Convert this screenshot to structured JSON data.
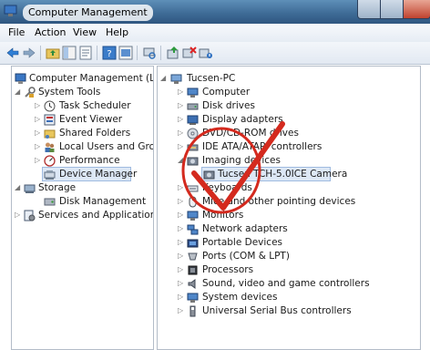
{
  "window": {
    "title": "Computer Management"
  },
  "menu": [
    "File",
    "Action",
    "View",
    "Help"
  ],
  "toolbar": {
    "icons": [
      "back-arrow-icon",
      "forward-arrow-icon",
      "up-folder-icon",
      "show-hide-tree-icon",
      "properties-icon",
      "help-icon",
      "console-tree-icon",
      "scan-hardware-icon",
      "update-driver-icon",
      "uninstall-device-icon",
      "disable-device-icon"
    ]
  },
  "left_tree": {
    "root": "Computer Management (Local",
    "system_tools": "System Tools",
    "task_scheduler": "Task Scheduler",
    "event_viewer": "Event Viewer",
    "shared_folders": "Shared Folders",
    "local_users": "Local Users and Groups",
    "performance": "Performance",
    "device_manager": "Device Manager",
    "storage": "Storage",
    "disk_management": "Disk Management",
    "services": "Services and Applications"
  },
  "device_tree": {
    "pc_name": "Tucsen-PC",
    "computer": "Computer",
    "disk_drives": "Disk drives",
    "display_adapters": "Display adapters",
    "dvd": "DVD/CD-ROM drives",
    "ide": "IDE ATA/ATAPI controllers",
    "imaging": "Imaging devices",
    "camera": "Tucsen TCH-5.0ICE Camera",
    "keyboards": "Keyboards",
    "mice": "Mice and other pointing devices",
    "monitors": "Monitors",
    "network": "Network adapters",
    "portable": "Portable Devices",
    "ports": "Ports (COM & LPT)",
    "processors": "Processors",
    "sound": "Sound, video and game controllers",
    "system_devices": "System devices",
    "usb": "Universal Serial Bus controllers"
  },
  "colors": {
    "checkmark": "#d42a1e",
    "selection": "#dde8f6",
    "titlebar": "#3f6c97"
  }
}
